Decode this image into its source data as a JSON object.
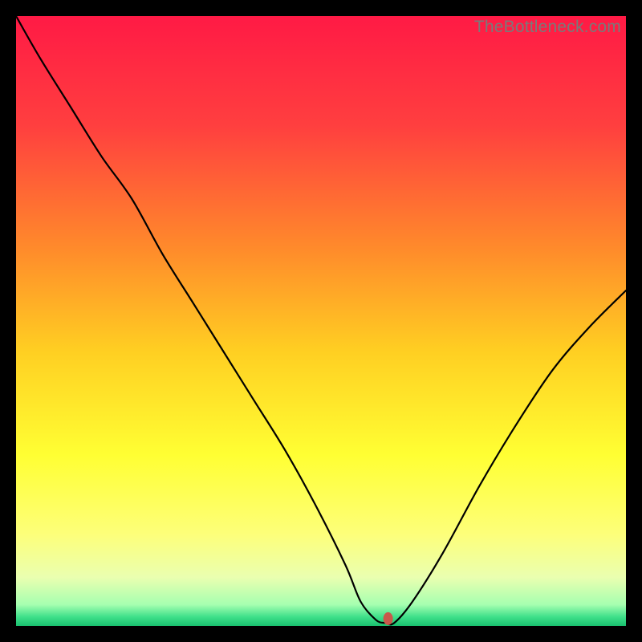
{
  "watermark": "TheBottleneck.com",
  "chart_data": {
    "type": "line",
    "title": "",
    "xlabel": "",
    "ylabel": "",
    "xlim": [
      0,
      100
    ],
    "ylim": [
      0,
      100
    ],
    "grid": false,
    "legend": false,
    "background_gradient": {
      "stops": [
        {
          "offset": 0.0,
          "color": "#ff1a45"
        },
        {
          "offset": 0.18,
          "color": "#ff3f3f"
        },
        {
          "offset": 0.38,
          "color": "#ff8a2b"
        },
        {
          "offset": 0.55,
          "color": "#ffcf22"
        },
        {
          "offset": 0.72,
          "color": "#ffff33"
        },
        {
          "offset": 0.85,
          "color": "#fdff7a"
        },
        {
          "offset": 0.92,
          "color": "#eaffb0"
        },
        {
          "offset": 0.965,
          "color": "#a6ffb0"
        },
        {
          "offset": 0.985,
          "color": "#3fe08a"
        },
        {
          "offset": 1.0,
          "color": "#19c06f"
        }
      ]
    },
    "series": [
      {
        "name": "bottleneck-curve",
        "color": "#000000",
        "stroke_width": 2.2,
        "x": [
          0,
          4,
          9,
          14,
          19,
          24,
          29,
          34,
          39,
          44,
          49,
          54,
          56.5,
          59,
          60.5,
          62,
          65,
          70,
          76,
          82,
          88,
          94,
          100
        ],
        "y": [
          100,
          93,
          85,
          77,
          70,
          61,
          53,
          45,
          37,
          29,
          20,
          10,
          4,
          1,
          0.5,
          0.5,
          4,
          12,
          23,
          33,
          42,
          49,
          55
        ]
      }
    ],
    "marker": {
      "name": "optimal-point",
      "x": 61,
      "y": 1.2,
      "rx": 6,
      "ry": 8,
      "color": "#c9584b"
    }
  }
}
